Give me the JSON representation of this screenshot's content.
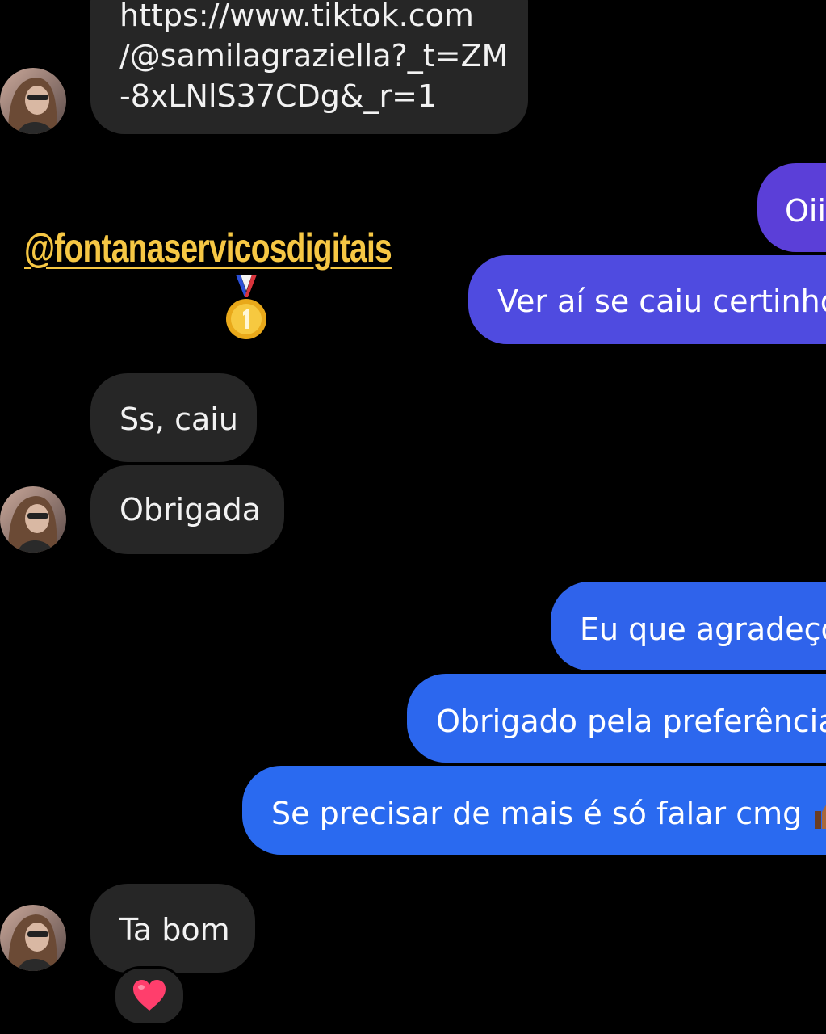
{
  "watermark": "@fontanaservicosdigitais",
  "messages": {
    "link_line1": "https://www.tiktok.com",
    "link_line2": "/@samilagraziella?_t=ZM",
    "link_line3": "-8xLNlS37CDg&_r=1",
    "oii": "Oii",
    "ver_ai": "Ver aí se caiu certinho",
    "ss_caiu": "Ss, caiu",
    "obrigada": "Obrigada",
    "eu_que": "Eu que agradeço",
    "obrigado_pref": "Obrigado pela preferência",
    "se_precisar": "Se precisar de mais é só falar cmg",
    "ta_bom": "Ta bom"
  },
  "icons": {
    "medal": "first-place-medal-icon",
    "thumb": "thumbs-up-icon",
    "reaction": "red-heart-icon",
    "avatar": "contact-avatar"
  },
  "colors": {
    "background": "#000000",
    "incoming_bubble": "#262626",
    "outgoing_top": "#5b3fd8",
    "outgoing_bottom": "#2a6af0",
    "watermark": "#f6c744",
    "heart": "#ff3e6c"
  }
}
